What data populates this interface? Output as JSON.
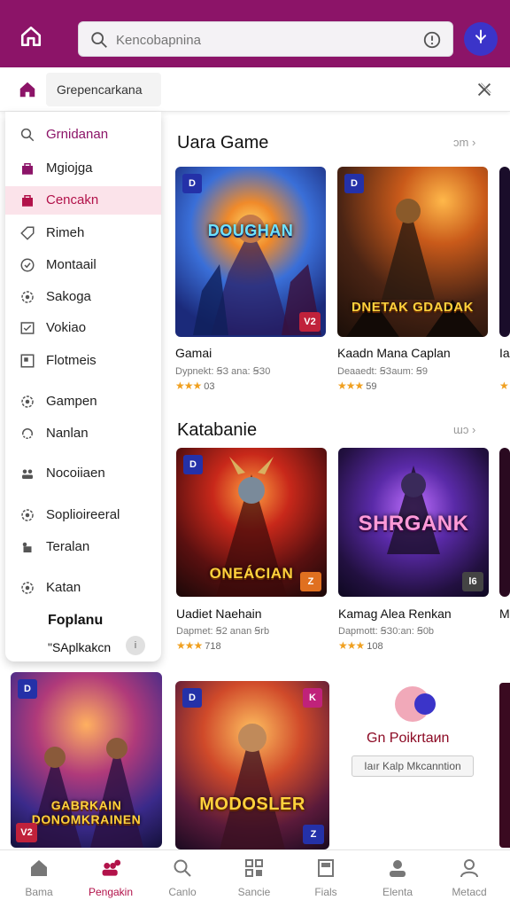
{
  "search": {
    "placeholder": "Kencobapnina"
  },
  "menu_header": {
    "title": "Grepencarkana"
  },
  "drawer": {
    "items": [
      {
        "label": "Grnidanan",
        "icon": "search-icon"
      },
      {
        "label": "Mgiojga",
        "icon": "bag-icon"
      },
      {
        "label": "Cencakn",
        "icon": "bag-icon"
      },
      {
        "label": "Rimeh",
        "icon": "tag-icon"
      },
      {
        "label": "Montaail",
        "icon": "shield-check-icon"
      },
      {
        "label": "Sakoga",
        "icon": "gear-icon"
      },
      {
        "label": "Vokiao",
        "icon": "check-box-icon"
      },
      {
        "label": "Flotmeis",
        "icon": "frame-icon"
      },
      {
        "label": "Gampen",
        "icon": "gear-icon"
      },
      {
        "label": "Nanlan",
        "icon": "sync-icon"
      },
      {
        "label": "Nocoiiaen",
        "icon": "group-icon"
      },
      {
        "label": "Soplioireeral",
        "icon": "gear-icon"
      },
      {
        "label": "Teralan",
        "icon": "puzzle-icon"
      },
      {
        "label": "Katan",
        "icon": "gear-icon"
      }
    ],
    "footer_title": "Foplanu",
    "footer_sub": "\"SAplkakcn",
    "footer_badge": "i"
  },
  "sections": [
    {
      "title": "Uara Game",
      "more": "ɔm",
      "cards": [
        {
          "name": "Gamai",
          "sub": "Dypnekt: ꞨЗ ana: ꞨЗ0",
          "stars": "★★★",
          "rating": "03",
          "art_title": "DOUGHAN",
          "art_tl": "D",
          "art_br": "V2"
        },
        {
          "name": "Kaadn Mana Caplan",
          "sub": "Deaaedt: ꞨЗaum: Ꞩ9",
          "stars": "★★★",
          "rating": "59",
          "art_title": "DNETAK GDADAK",
          "art_tl": "D",
          "art_br": ""
        },
        {
          "name": "Ia",
          "sub": "",
          "stars": "★",
          "rating": "",
          "art_title": "",
          "art_tl": "",
          "art_br": ""
        }
      ]
    },
    {
      "title": "Katabanie",
      "more": "ɯɔ",
      "cards": [
        {
          "name": "Uadiet Naehain",
          "sub": "Dapmet: Ꞩ2 anan Ꞩrb",
          "stars": "★★★",
          "rating": "718",
          "art_title": "ONEÁCIAN",
          "art_tl": "D",
          "art_br": "Z"
        },
        {
          "name": "Kamag Alea Renkan",
          "sub": "Dapmott: ꞨЗ0:an: Ꞩ0b",
          "stars": "★★★",
          "rating": "108",
          "art_title": "SHRGANK",
          "art_tl": "D",
          "art_br": "l6"
        },
        {
          "name": "M",
          "sub": "",
          "stars": "",
          "rating": "",
          "art_title": "",
          "art_tl": "",
          "art_br": ""
        }
      ]
    }
  ],
  "bottom_row": {
    "cards": [
      {
        "art_title": "GABRKAIN DONOMKRAINEN",
        "art_tl": "D",
        "art_br": "V2"
      },
      {
        "art_title": "MODOSLER",
        "art_tl": "D",
        "art_br": "Z",
        "art_tr": "K"
      }
    ],
    "promo": {
      "title": "Gn Poikrtaиn",
      "button": "Iaır Kalp Mkcanntion"
    }
  },
  "bottom_nav": [
    {
      "label": "Bama",
      "icon": "home-icon",
      "active": false
    },
    {
      "label": "Pengakin",
      "icon": "people-icon",
      "active": true
    },
    {
      "label": "Canlo",
      "icon": "search-icon",
      "active": false
    },
    {
      "label": "Sancie",
      "icon": "qr-icon",
      "active": false
    },
    {
      "label": "Fials",
      "icon": "card-icon",
      "active": false
    },
    {
      "label": "Elenta",
      "icon": "person-icon",
      "active": false
    },
    {
      "label": "Metacd",
      "icon": "person-outline-icon",
      "active": false
    }
  ],
  "colors": {
    "brand": "#8c1468",
    "accent": "#b2124a",
    "mic": "#3b34c9",
    "star": "#f0a020"
  }
}
